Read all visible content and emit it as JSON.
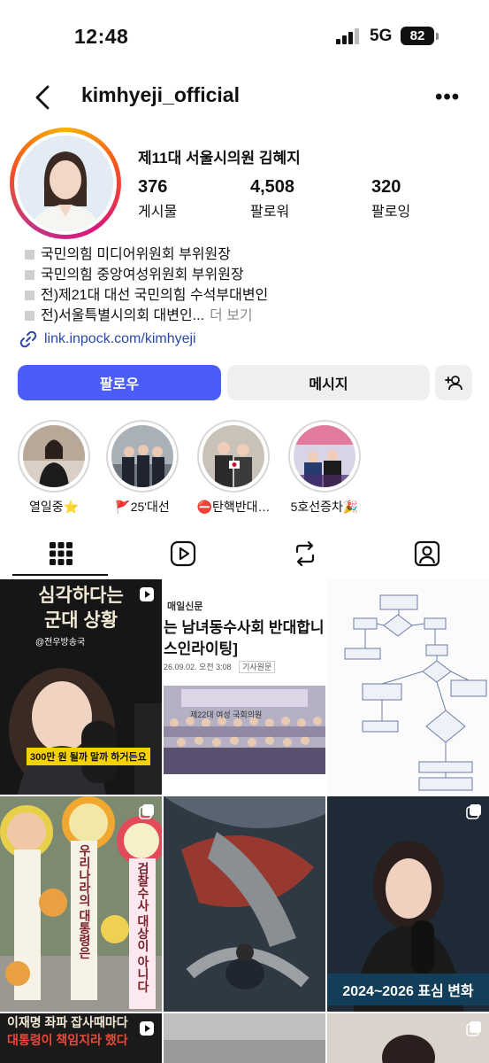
{
  "status_bar": {
    "time": "12:48",
    "network": "5G",
    "battery": "82"
  },
  "header": {
    "username": "kimhyeji_official",
    "back_icon": "chevron-left-icon",
    "more_icon": "more-dots-icon"
  },
  "profile": {
    "full_name": "제11대 서울시의원 김혜지",
    "stats": [
      {
        "value": "376",
        "label": "게시물"
      },
      {
        "value": "4,508",
        "label": "팔로워"
      },
      {
        "value": "320",
        "label": "팔로잉"
      }
    ],
    "bio": [
      "국민의힘 미디어위원회 부위원장",
      "국민의힘 중앙여성위원회 부위원장",
      "전)제21대 대선 국민의힘 수석부대변인",
      "전)서울특별시의회 대변인..."
    ],
    "bio_more": "더 보기",
    "link": "link.inpock.com/kimhyeji"
  },
  "actions": {
    "follow": "팔로우",
    "message": "메시지",
    "add_person_icon": "add-person-icon"
  },
  "highlights": [
    {
      "label": "열일중⭐"
    },
    {
      "label": "🚩25'대선"
    },
    {
      "label": "⛔탄핵반대…"
    },
    {
      "label": "5호선증차🎉"
    }
  ],
  "tabs": [
    {
      "name": "grid",
      "icon": "grid-icon"
    },
    {
      "name": "reels",
      "icon": "reels-icon"
    },
    {
      "name": "reposts",
      "icon": "repost-icon"
    },
    {
      "name": "tagged",
      "icon": "tagged-person-icon"
    }
  ],
  "posts": [
    {
      "title1": "심각하다는",
      "title2": "군대 상황",
      "tag": "@전우방송국",
      "caption": "300만 원 될까 말까 하거든요"
    },
    {
      "source": "매일신문",
      "headline1": "는 남녀동수사회 반대합니",
      "headline2": "스인라이팅]",
      "meta": "26.09.02. 오전 3:08",
      "badge": "기사원문",
      "banner": "제22대 여성 국회의원"
    },
    {
      "kind": "flowchart"
    },
    {
      "ribbon1": "우리나라의 대통령은",
      "ribbon2": "검찰수사 대상이 아니다"
    },
    {
      "kind": "illustration"
    },
    {
      "caption": "2024~2026 표심 변화"
    },
    {
      "line1": "이재명 좌파 잡사때마다",
      "line2": "대통령이 책임지라 했다"
    },
    {
      "kind": "photo"
    },
    {
      "kind": "photo"
    }
  ]
}
